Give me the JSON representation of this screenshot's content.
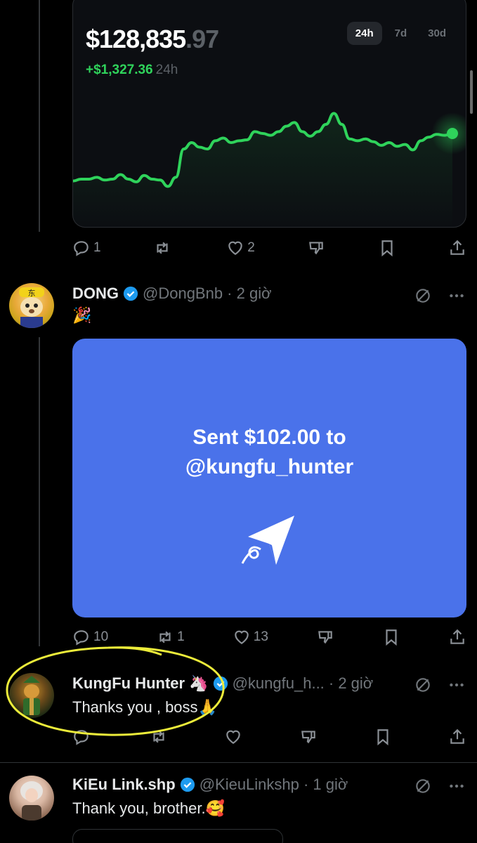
{
  "chart_card": {
    "balance_main": "$128,835",
    "balance_cents": ".97",
    "change": "+$1,327.36",
    "change_period": "24h",
    "ranges": [
      "24h",
      "7d",
      "30d"
    ],
    "active_range": "24h",
    "line_color": "#2fd35b"
  },
  "chart_data": {
    "type": "line",
    "series": [
      {
        "values": [
          0.18,
          0.2,
          0.2,
          0.22,
          0.19,
          0.2,
          0.25,
          0.2,
          0.17,
          0.24,
          0.2,
          0.19,
          0.12,
          0.22,
          0.53,
          0.6,
          0.55,
          0.53,
          0.62,
          0.65,
          0.6,
          0.62,
          0.63,
          0.72,
          0.7,
          0.68,
          0.72,
          0.78,
          0.82,
          0.72,
          0.67,
          0.72,
          0.8,
          0.92,
          0.8,
          0.64,
          0.62,
          0.64,
          0.61,
          0.57,
          0.6,
          0.56,
          0.58,
          0.52,
          0.62,
          0.66,
          0.69,
          0.68,
          0.7
        ]
      }
    ],
    "color": "#2fd35b"
  },
  "post1_actions": {
    "reply": "1",
    "repost": "",
    "like": "2"
  },
  "post2": {
    "name": "DONG",
    "handle": "@DongBnb · 2 giờ",
    "text": "🎉",
    "pay_line1": "Sent $102.00 to",
    "pay_line2": "@kungfu_hunter",
    "pay_color": "#4a72ea",
    "actions": {
      "reply": "10",
      "repost": "1",
      "like": "13"
    }
  },
  "post3": {
    "name": "KungFu Hunter 🦄",
    "handle": "@kungfu_h... · 2 giờ",
    "text": "Thanks you , boss🙏",
    "actions": {
      "reply": "",
      "repost": "",
      "like": ""
    }
  },
  "post4": {
    "name": "KiEu Link.shp",
    "handle": "@KieuLinkshp · 1 giờ",
    "text": "Thank you, brother.🥰"
  }
}
